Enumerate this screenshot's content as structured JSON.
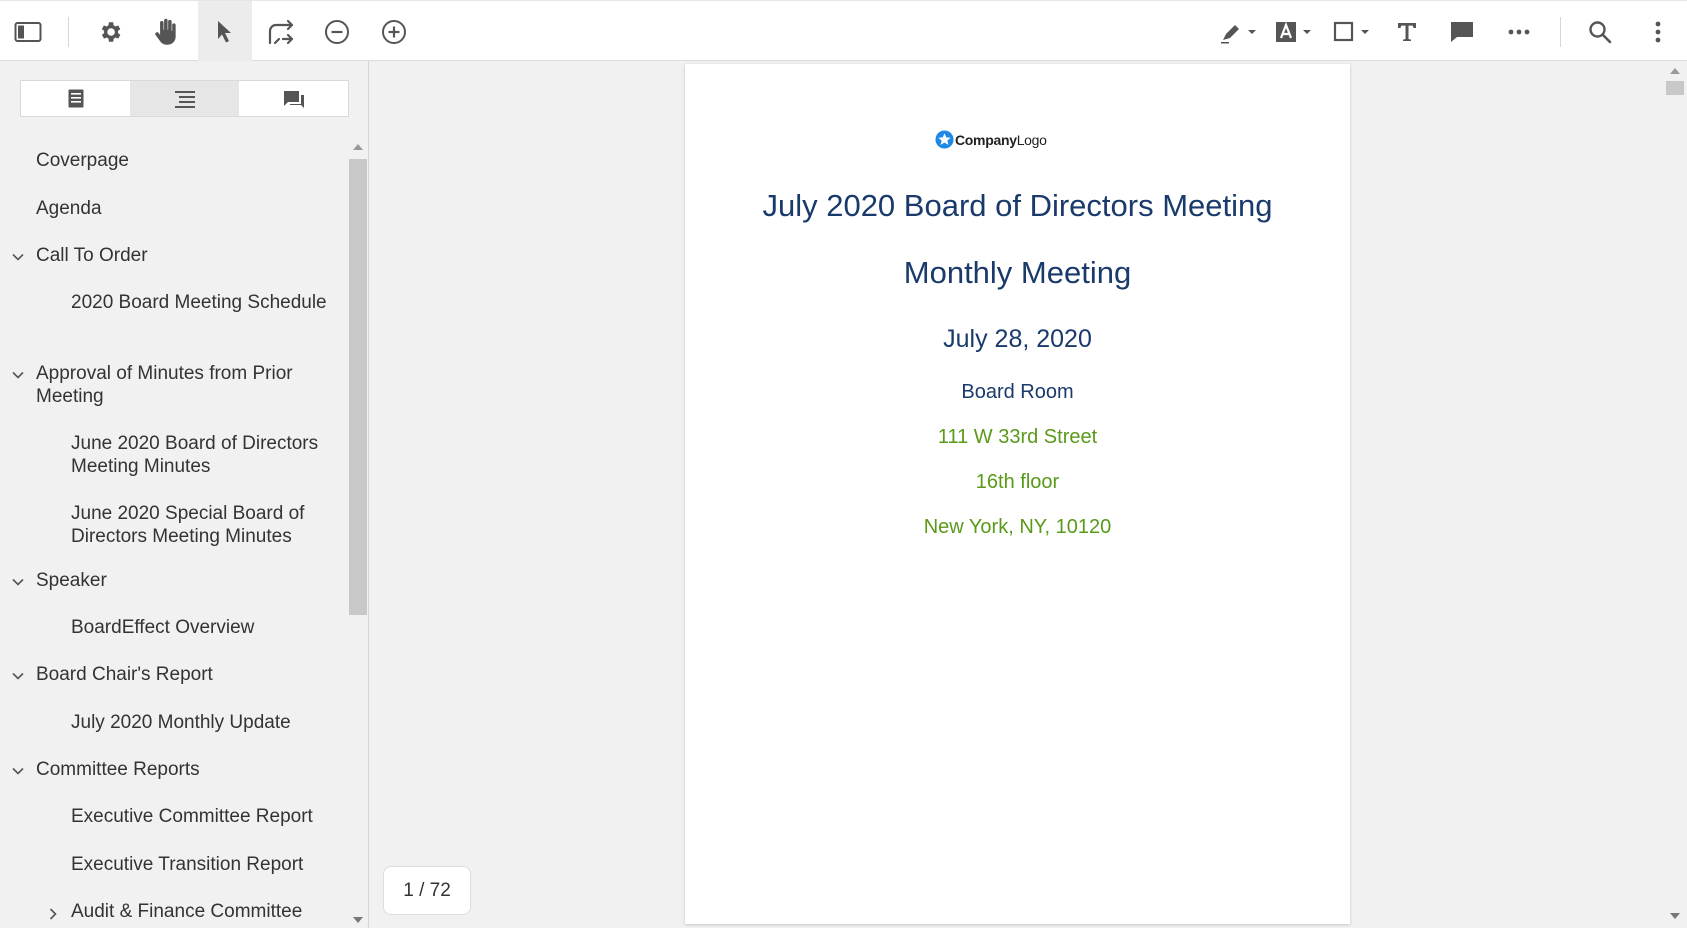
{
  "toolbar": {
    "left_icons": [
      "sidebar-toggle-icon",
      "gear-icon",
      "hand-pan-icon",
      "pointer-select-icon",
      "page-transition-icon",
      "zoom-out-icon",
      "zoom-in-icon"
    ],
    "right_icons": [
      "highlighter-icon",
      "text-highlight-icon",
      "rectangle-shape-icon",
      "text-tool-icon",
      "comment-icon",
      "more-horizontal-icon",
      "search-icon",
      "more-vertical-icon"
    ]
  },
  "sidebar": {
    "tabs": [
      "thumbnails-tab",
      "outline-tab",
      "comments-tab"
    ],
    "selected_tab": "outline-tab",
    "outline": [
      {
        "label": "Coverpage",
        "level": 1,
        "expandable": false
      },
      {
        "label": "Agenda",
        "level": 1,
        "expandable": false
      },
      {
        "label": "Call To Order",
        "level": 1,
        "expandable": true,
        "expanded": true
      },
      {
        "label": "2020 Board Meeting Schedule",
        "level": 2
      },
      {
        "label": "Approval of Minutes from Prior Meeting",
        "level": 1,
        "expandable": true,
        "expanded": true
      },
      {
        "label": "June 2020 Board of Directors Meeting Minutes",
        "level": 2
      },
      {
        "label": "June 2020 Special Board of Directors Meeting Minutes",
        "level": 2
      },
      {
        "label": "Speaker",
        "level": 1,
        "expandable": true,
        "expanded": true
      },
      {
        "label": "BoardEffect Overview",
        "level": 2
      },
      {
        "label": "Board Chair's Report",
        "level": 1,
        "expandable": true,
        "expanded": true
      },
      {
        "label": "July 2020 Monthly Update",
        "level": 2
      },
      {
        "label": "Committee Reports",
        "level": 1,
        "expandable": true,
        "expanded": true
      },
      {
        "label": "Executive Committee Report",
        "level": 2
      },
      {
        "label": "Executive Transition Report",
        "level": 2
      },
      {
        "label": "Audit & Finance Committee",
        "level": 2,
        "expandable": true,
        "expanded": false
      }
    ]
  },
  "document": {
    "logo_bold": "Company",
    "logo_rest": "Logo",
    "title": "July 2020 Board of Directors Meeting",
    "subtitle": "Monthly Meeting",
    "date": "July 28, 2020",
    "room": "Board Room",
    "address_line1": "111 W 33rd Street",
    "address_line2": "16th floor",
    "address_line3": "New York, NY, 10120",
    "colors": {
      "heading": "#1a3a6b",
      "address": "#5a9a1a",
      "logo_icon": "#1e88e5"
    }
  },
  "pagination": {
    "label": "1 / 72"
  }
}
